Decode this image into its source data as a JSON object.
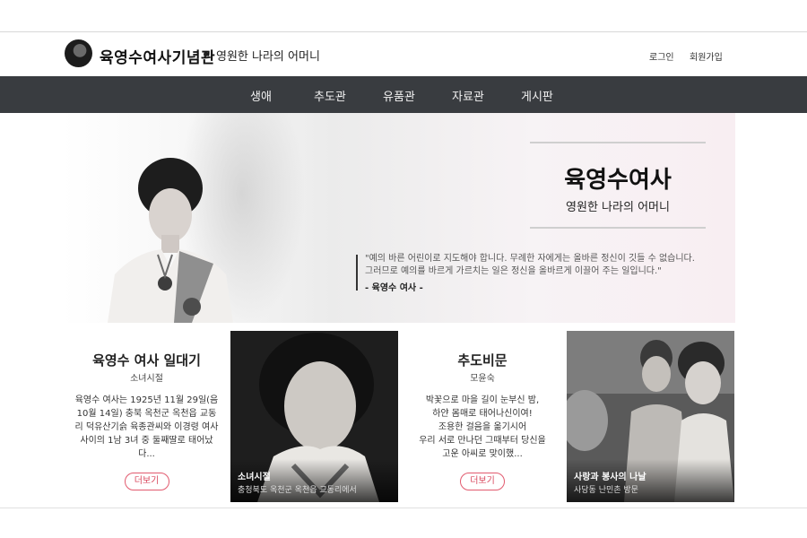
{
  "header": {
    "title": "육영수여사기념관",
    "tagline": "영원한 나라의 어머니",
    "login": "로그인",
    "join": "회원가입"
  },
  "nav": [
    "생애",
    "추도관",
    "유품관",
    "자료관",
    "게시판"
  ],
  "hero": {
    "name": "육영수여사",
    "subtitle": "영원한 나라의 어머니",
    "quote_line1": "\"예의 바른 어린이로 지도해야 합니다. 무례한 자에게는 올바른 정신이 깃들 수 없습니다.",
    "quote_line2": "그러므로 예의를 바르게 가르치는 일은 정신을 올바르게 이끌어 주는 일입니다.\"",
    "author": "- 육영수 여사 -"
  },
  "cards": {
    "biography": {
      "title": "육영수 여사 일대기",
      "subtitle": "소녀시절",
      "body": "육영수 여사는 1925년 11월 29일(음 10월 14일) 충북 옥천군 옥천읍 교동리 덕유산기슭 육종관씨와 이경령 여사사이의 1남 3녀 중 둘째딸로 태어났다...",
      "button": "더보기"
    },
    "girlhood_photo": {
      "caption_title": "소녀시절",
      "caption_sub": "충청북도 옥천군 옥천읍 교동리에서"
    },
    "memorial": {
      "title": "추도비문",
      "subtitle": "모윤숙",
      "lines": [
        "박꽃으로 마을 길이 눈부신 밤,",
        "하얀 몸매로 태어나신이여!",
        "조용한 걸음을 옮기시어",
        "우리 서로 만나던 그때부터 당신을",
        "고운 아씨로 맞이했..."
      ],
      "button": "더보기"
    },
    "service_photo": {
      "caption_title": "사랑과 봉사의 나날",
      "caption_sub": "사당동 난민촌 방문"
    }
  },
  "colors": {
    "nav_bg": "#393c40",
    "accent": "#e25a6e"
  },
  "icons": {
    "logo": "portrait-logo-icon"
  }
}
